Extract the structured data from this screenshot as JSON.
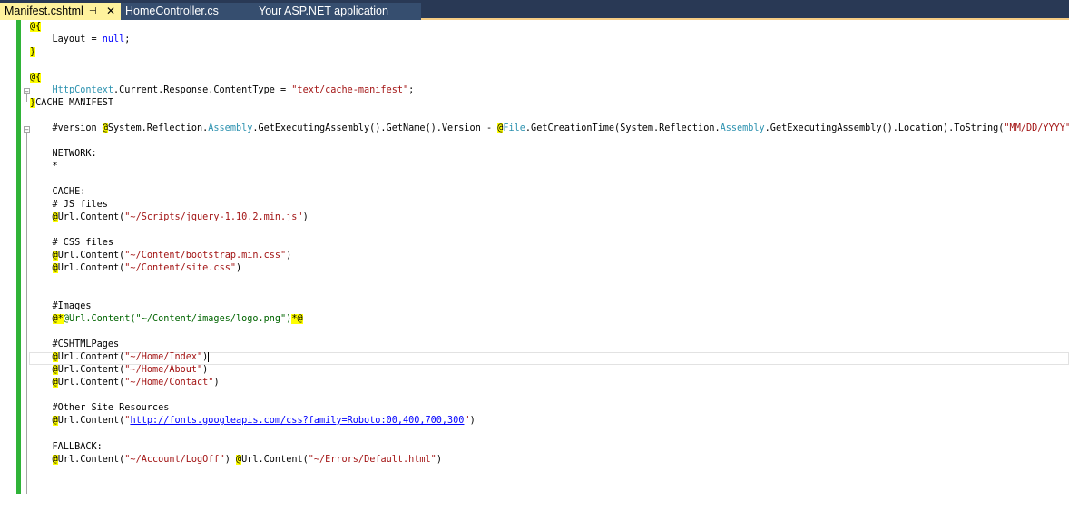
{
  "tabs": [
    {
      "label": "Manifest.cshtml",
      "pin": "⊣",
      "close": "✕"
    },
    {
      "label": "HomeController.cs"
    },
    {
      "label": "Your ASP.NET application"
    }
  ],
  "code": {
    "l1": "@{",
    "l2a": "    Layout = ",
    "l2b": "null",
    "l2c": ";",
    "l3": "}",
    "l5": "@{",
    "l6a": "    ",
    "l6b": "HttpContext",
    "l6c": ".Current.Response.ContentType = ",
    "l6d": "\"text/cache-manifest\"",
    "l6e": ";",
    "l7a": "}",
    "l7b": "CACHE MANIFEST",
    "l9a": "    #version ",
    "l9b": "@",
    "l9c": "System.Reflection.",
    "l9d": "Assembly",
    "l9e": ".GetExecutingAssembly().GetName().Version - ",
    "l9f": "@",
    "l9g": "File",
    "l9h": ".GetCreationTime(System.Reflection.",
    "l9i": "Assembly",
    "l9j": ".GetExecutingAssembly().Location).ToString(",
    "l9k": "\"MM/DD/YYYY\"",
    "l9l": ")",
    "l11": "    NETWORK:",
    "l12": "    *",
    "l14": "    CACHE:",
    "l15": "    # JS files",
    "l16a": "    ",
    "l16b": "@",
    "l16c": "Url.Content(",
    "l16d": "\"~/Scripts/jquery-1.10.2.min.js\"",
    "l16e": ")",
    "l18": "    # CSS files",
    "l19a": "    ",
    "l19b": "@",
    "l19c": "Url.Content(",
    "l19d": "\"~/Content/bootstrap.min.css\"",
    "l19e": ")",
    "l20a": "    ",
    "l20b": "@",
    "l20c": "Url.Content(",
    "l20d": "\"~/Content/site.css\"",
    "l20e": ")",
    "l23": "    #Images",
    "l24a": "    ",
    "l24b": "@*",
    "l24c": "@Url.Content(\"~/Content/images/logo.png\")",
    "l24d": "*@",
    "l26": "    #CSHTMLPages",
    "l27a": "    ",
    "l27b": "@",
    "l27c": "Url.Content(",
    "l27d": "\"~/Home/Index\"",
    "l27e": ")",
    "l28a": "    ",
    "l28b": "@",
    "l28c": "Url.Content(",
    "l28d": "\"~/Home/About\"",
    "l28e": ")",
    "l29a": "    ",
    "l29b": "@",
    "l29c": "Url.Content(",
    "l29d": "\"~/Home/Contact\"",
    "l29e": ")",
    "l31": "    #Other Site Resources",
    "l32a": "    ",
    "l32b": "@",
    "l32c": "Url.Content(",
    "l32d": "\"",
    "l32e": "http://fonts.googleapis.com/css?family=Roboto:00,400,700,300",
    "l32f": "\"",
    "l32g": ")",
    "l34": "    FALLBACK:",
    "l35a": "    ",
    "l35b": "@",
    "l35c": "Url.Content(",
    "l35d": "\"~/Account/LogOff\"",
    "l35e": ") ",
    "l35f": "@",
    "l35g": "Url.Content(",
    "l35h": "\"~/Errors/Default.html\"",
    "l35i": ")"
  },
  "colors": {
    "margin_bar": "#2fb338",
    "tab_active": "#fff29d",
    "tab_bar": "#293955",
    "razor_highlight": "#ffff00"
  }
}
